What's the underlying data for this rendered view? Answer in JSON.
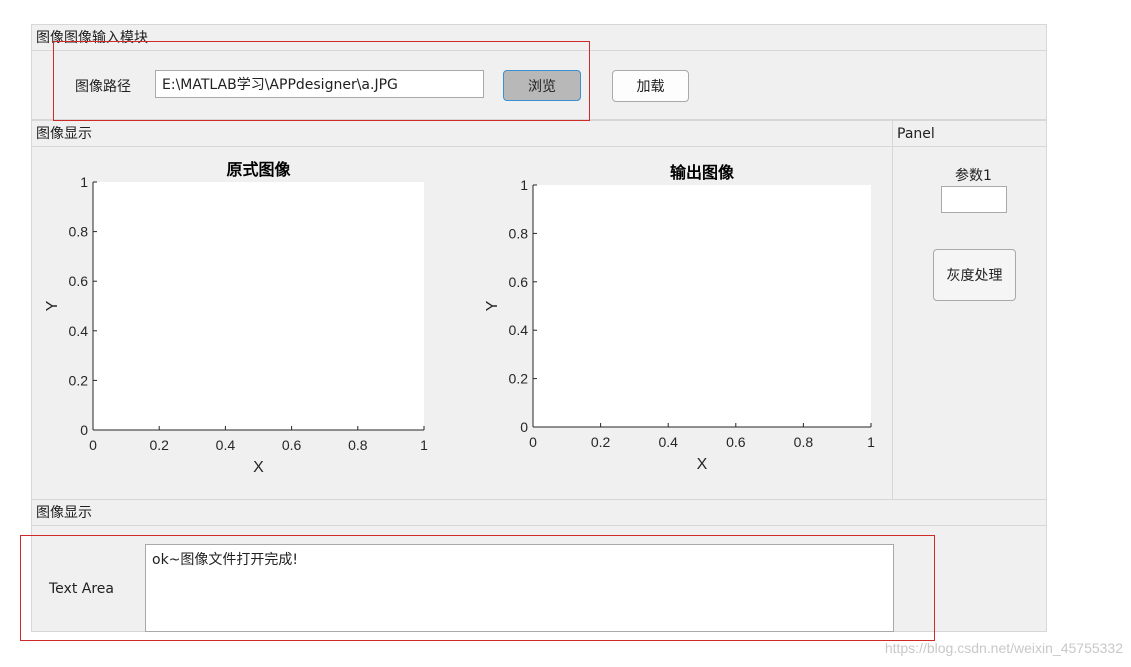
{
  "input_panel": {
    "title": "图像图像输入模块",
    "path_label": "图像路径",
    "path_value": "E:\\MATLAB学习\\APPdesigner\\a.JPG",
    "browse_label": "浏览",
    "load_label": "加载"
  },
  "display_panel": {
    "title": "图像显示"
  },
  "side_panel": {
    "title": "Panel",
    "param_label": "参数1",
    "param_value": "",
    "gray_button_label": "灰度处理"
  },
  "text_panel": {
    "title": "图像显示",
    "text_area_label": "Text Area",
    "text_area_value": "ok~图像文件打开完成!"
  },
  "watermark": "https://blog.csdn.net/weixin_45755332",
  "chart_data": [
    {
      "type": "line",
      "title": "原式图像",
      "xlabel": "X",
      "ylabel": "Y",
      "xlim": [
        0,
        1
      ],
      "ylim": [
        0,
        1
      ],
      "xticks": [
        "0",
        "0.2",
        "0.4",
        "0.6",
        "0.8",
        "1"
      ],
      "yticks": [
        "0",
        "0.2",
        "0.4",
        "0.6",
        "0.8",
        "1"
      ],
      "series": [],
      "grid": false
    },
    {
      "type": "line",
      "title": "输出图像",
      "xlabel": "X",
      "ylabel": "Y",
      "xlim": [
        0,
        1
      ],
      "ylim": [
        0,
        1
      ],
      "xticks": [
        "0",
        "0.2",
        "0.4",
        "0.6",
        "0.8",
        "1"
      ],
      "yticks": [
        "0",
        "0.2",
        "0.4",
        "0.6",
        "0.8",
        "1"
      ],
      "series": [],
      "grid": false
    }
  ]
}
